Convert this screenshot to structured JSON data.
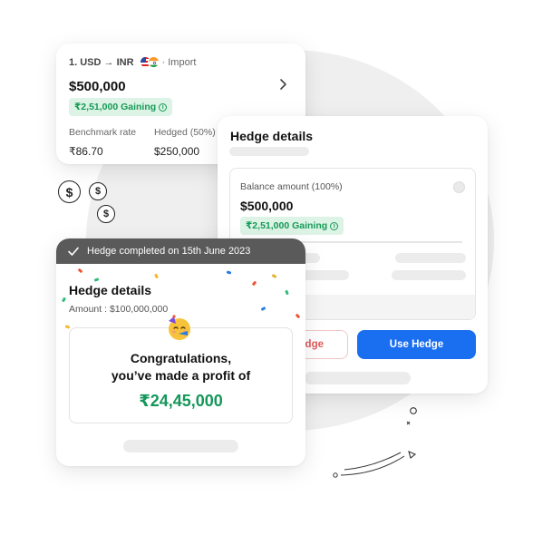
{
  "trade_card": {
    "pair": "1. USD → INR",
    "type": "· Import",
    "amount": "$500,000",
    "gain": "₹2,51,000 Gaining",
    "info_glyph": "i",
    "columns": [
      {
        "label": "Benchmark rate",
        "value": "₹86.70"
      },
      {
        "label": "Hedged (50%)",
        "value": "$250,000"
      }
    ]
  },
  "dollar_icons": [
    "$",
    "$",
    "$"
  ],
  "hedge_panel": {
    "title": "Hedge details",
    "balance_label": "Balance amount (100%)",
    "balance_amount": "$500,000",
    "gain": "₹2,51,000 Gaining",
    "secondary_button": "dge",
    "primary_button": "Use Hedge"
  },
  "completed_card": {
    "banner": "Hedge completed on 15th June 2023",
    "title": "Hedge details",
    "amount_line": "Amount : $100,000,000",
    "congrats_line1": "Congratulations,",
    "congrats_line2": "you’ve made a profit of",
    "profit": "₹24,45,000"
  },
  "colors": {
    "primary": "#1a6ef0",
    "gain_green": "#169a55",
    "gain_bg": "#dcf3e6",
    "banner_bg": "#5a5a5a"
  }
}
